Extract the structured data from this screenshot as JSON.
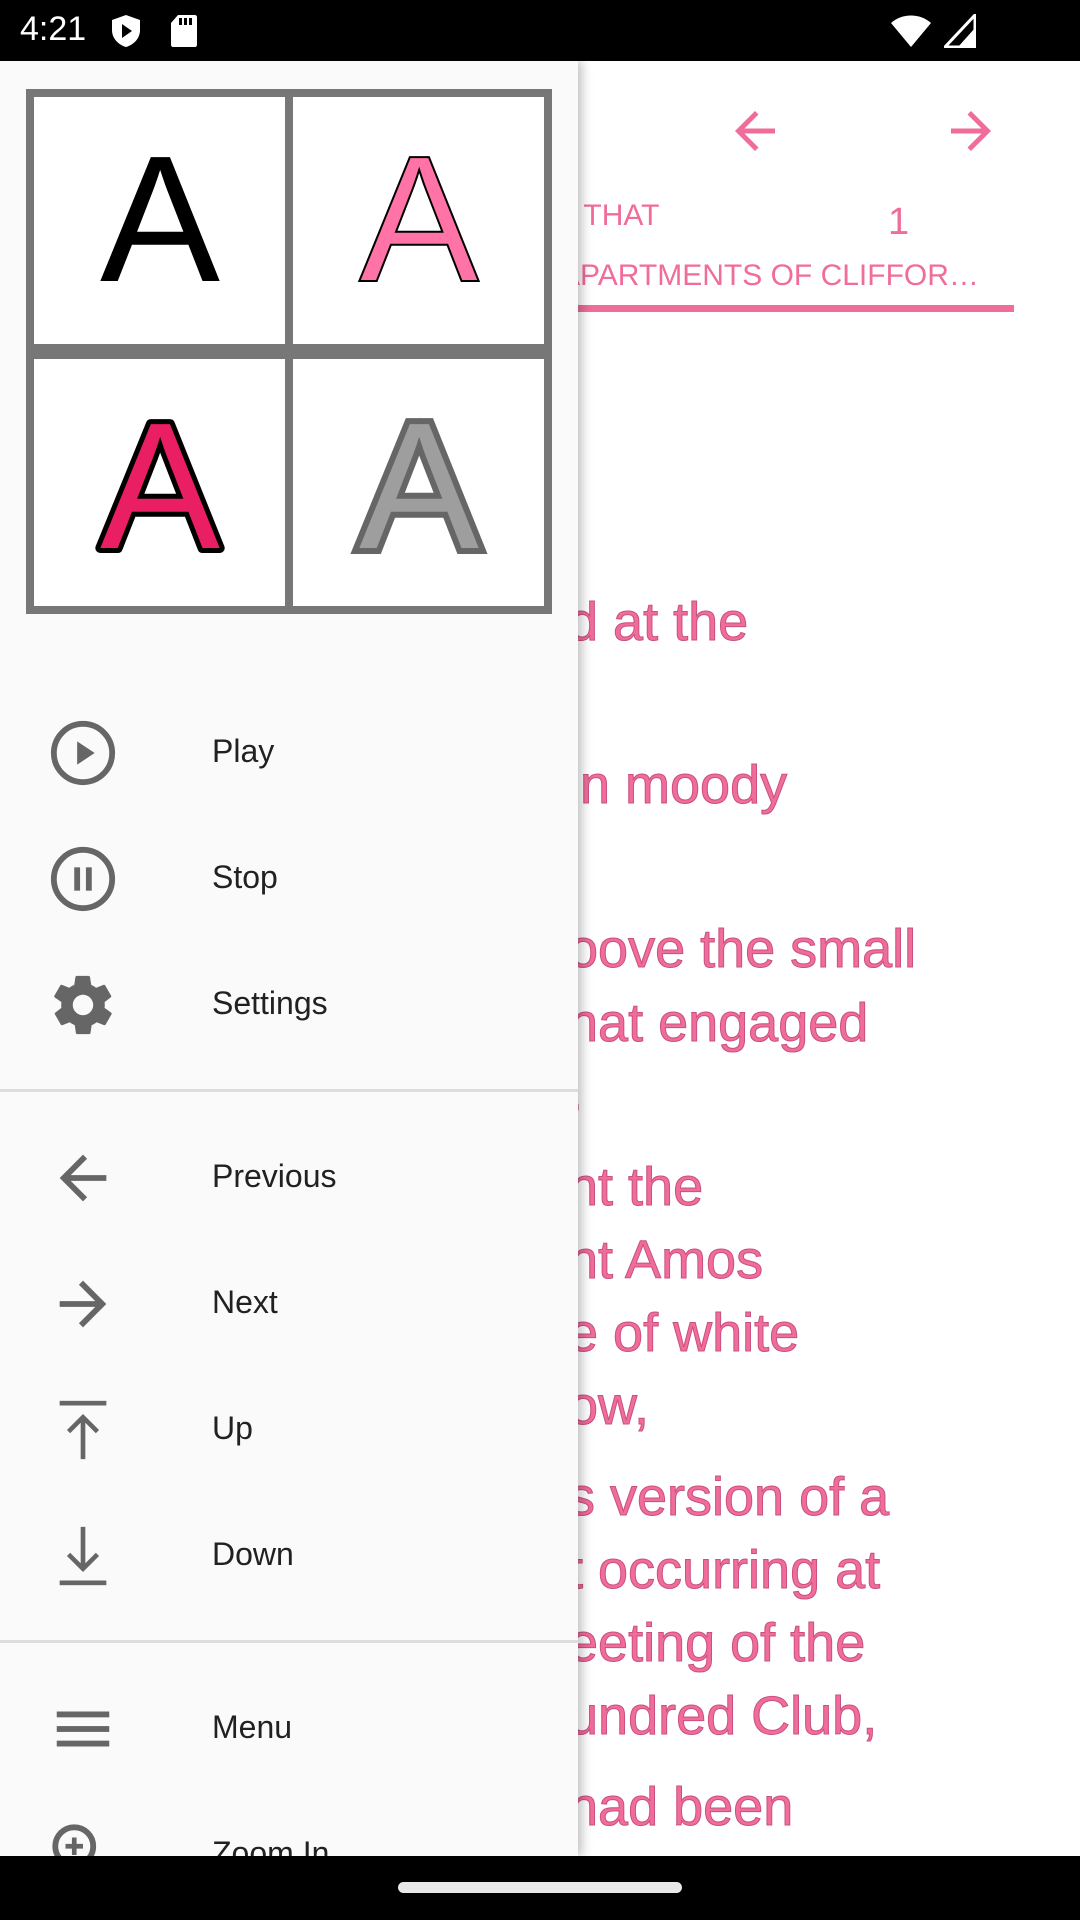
{
  "status_bar": {
    "time": "4:21",
    "icons": [
      "play-protect-icon",
      "sd-card-icon",
      "wifi-icon",
      "signal-icon"
    ]
  },
  "reader": {
    "prev_chapter_title": "L THAT",
    "page_number": "1",
    "current_chapter_title": "APARTMENTS OF CLIFFOR…",
    "accent_color": "#f06c9b",
    "lines": [
      "d at the",
      "in moody",
      "oove the small",
      "hat engaged",
      ".",
      "nt the",
      "nt Amos",
      "e of white",
      "ow,",
      "s version of a",
      "t occurring at",
      "eeting of the",
      "undred Club,",
      "had been"
    ]
  },
  "drawer": {
    "style_tiles": [
      "A",
      "A",
      "A",
      "A"
    ],
    "items": [
      {
        "label": "Play",
        "icon": "play-circle-icon"
      },
      {
        "label": "Stop",
        "icon": "pause-circle-icon"
      },
      {
        "label": "Settings",
        "icon": "gear-icon"
      },
      {
        "label": "Previous",
        "icon": "arrow-left-icon"
      },
      {
        "label": "Next",
        "icon": "arrow-right-icon"
      },
      {
        "label": "Up",
        "icon": "arrow-up-to-top-icon"
      },
      {
        "label": "Down",
        "icon": "arrow-down-to-bottom-icon"
      },
      {
        "label": "Menu",
        "icon": "menu-icon"
      },
      {
        "label": "Zoom In",
        "icon": "zoom-in-icon"
      }
    ]
  }
}
